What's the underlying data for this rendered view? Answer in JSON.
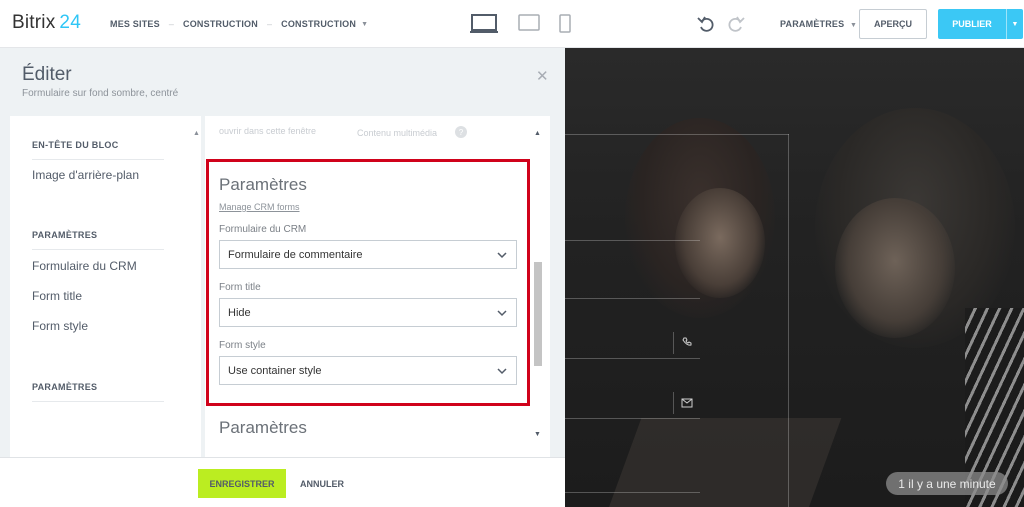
{
  "app": {
    "logo_name": "Bitrix",
    "logo_num": "24"
  },
  "nav": {
    "my_sites": "MES SITES",
    "crumb1": "CONSTRUCTION",
    "crumb2": "CONSTRUCTION"
  },
  "toolbar": {
    "params": "PARAMÈTRES",
    "preview": "APERÇU",
    "publish": "PUBLIER"
  },
  "editor": {
    "title": "Éditer",
    "subtitle": "Formulaire sur fond sombre, centré"
  },
  "leftnav": {
    "header1": "EN-TÊTE DU BLOC",
    "item_bg_image": "Image d'arrière-plan",
    "header2": "PARAMÈTRES",
    "item_crm_form": "Formulaire du CRM",
    "item_form_title": "Form title",
    "item_form_style": "Form style",
    "header3": "PARAMÈTRES"
  },
  "content": {
    "faded_text": "ouvrir dans cette fenêtre",
    "faded_text2": "Contenu multimédia",
    "faded_q": "?",
    "section_title": "Paramètres",
    "manage_link": "Manage CRM forms",
    "crm_label": "Formulaire du CRM",
    "crm_value": "Formulaire de commentaire",
    "title_label": "Form title",
    "title_value": "Hide",
    "style_label": "Form style",
    "style_value": "Use container style",
    "section_title2": "Paramètres"
  },
  "footer": {
    "save": "ENREGISTRER",
    "cancel": "ANNULER"
  },
  "preview": {
    "toast": "1 il y a une minute"
  },
  "colors": {
    "accent": "#3bc8f5",
    "save": "#bbed21",
    "highlight": "#d0021b",
    "logo_num": "#2fc6f6"
  }
}
